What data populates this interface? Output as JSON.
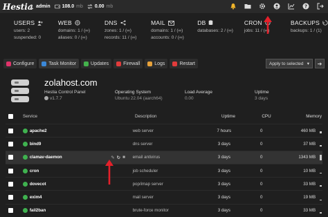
{
  "topbar": {
    "logo": "Hestia",
    "user": "admin",
    "disk_value": "108.0",
    "disk_unit": "mb",
    "bw_value": "0.00",
    "bw_unit": "mb",
    "icons": [
      "bell-icon",
      "folder-icon",
      "gear-icon",
      "user-icon",
      "chart-icon",
      "help-icon",
      "logout-icon"
    ]
  },
  "stats": [
    {
      "name": "USERS",
      "lines": [
        [
          "users:",
          "2"
        ],
        [
          "suspended:",
          "0"
        ]
      ]
    },
    {
      "name": "WEB",
      "lines": [
        [
          "domains:",
          "1 / (∞)"
        ],
        [
          "aliases:",
          "0 / (∞)"
        ]
      ]
    },
    {
      "name": "DNS",
      "lines": [
        [
          "zones:",
          "1 / (∞)"
        ],
        [
          "records:",
          "11 / (∞)"
        ]
      ]
    },
    {
      "name": "MAIL",
      "lines": [
        [
          "domains:",
          "1 / (∞)"
        ],
        [
          "accounts:",
          "0 / (∞)"
        ]
      ]
    },
    {
      "name": "DB",
      "lines": [
        [
          "databases:",
          "2 / (∞)"
        ]
      ]
    },
    {
      "name": "CRON",
      "lines": [
        [
          "jobs:",
          "11 / (∞)"
        ]
      ]
    },
    {
      "name": "BACKUPS",
      "lines": [
        [
          "backups:",
          "1 / (1)"
        ]
      ]
    }
  ],
  "tabs": [
    {
      "label": "Configure",
      "color": "#e0336a",
      "active": false
    },
    {
      "label": "Task Monitor",
      "color": "#3b88d8",
      "active": true
    },
    {
      "label": "Updates",
      "color": "#44b24c",
      "active": false
    },
    {
      "label": "Firewall",
      "color": "#e23b3b",
      "active": false
    },
    {
      "label": "Logs",
      "color": "#e8a23a",
      "active": false
    },
    {
      "label": "Restart",
      "color": "#e23b3b",
      "active": false
    }
  ],
  "apply_label": "Apply to selected",
  "server": {
    "hostname": "zolahost.com",
    "panel": "Hestia Control Panel",
    "version": "v1.7.7",
    "os_label": "Operating System",
    "os_value": "Ubuntu 22.04 (aarch64)",
    "load_label": "Load Average",
    "load_value": "0.00",
    "uptime_label": "Uptime",
    "uptime_value": "3 days"
  },
  "table": {
    "headers": {
      "service": "Service",
      "description": "Description",
      "uptime": "Uptime",
      "cpu": "CPU",
      "memory": "Memory"
    },
    "rows": [
      {
        "service": "apache2",
        "description": "web server",
        "uptime": "7 hours",
        "cpu": "0",
        "memory": "460 MB",
        "mem_level": 0.4
      },
      {
        "service": "bind9",
        "description": "dns server",
        "uptime": "3 days",
        "cpu": "0",
        "memory": "37 MB",
        "mem_level": 0.2
      },
      {
        "service": "clamav-daemon",
        "description": "email antivirus",
        "uptime": "3 days",
        "cpu": "0",
        "memory": "1343 MB",
        "mem_level": 1.0,
        "highlight": true
      },
      {
        "service": "cron",
        "description": "job scheduler",
        "uptime": "3 days",
        "cpu": "0",
        "memory": "10 MB",
        "mem_level": 0.1
      },
      {
        "service": "dovecot",
        "description": "pop/imap server",
        "uptime": "3 days",
        "cpu": "0",
        "memory": "33 MB",
        "mem_level": 0.2
      },
      {
        "service": "exim4",
        "description": "mail server",
        "uptime": "3 days",
        "cpu": "0",
        "memory": "19 MB",
        "mem_level": 0.15
      },
      {
        "service": "fail2ban",
        "description": "brute-force monitor",
        "uptime": "3 days",
        "cpu": "0",
        "memory": "33 MB",
        "mem_level": 0.2
      }
    ]
  },
  "colors": {
    "accent_red": "#e5202a",
    "ok_green": "#3fb24f"
  }
}
